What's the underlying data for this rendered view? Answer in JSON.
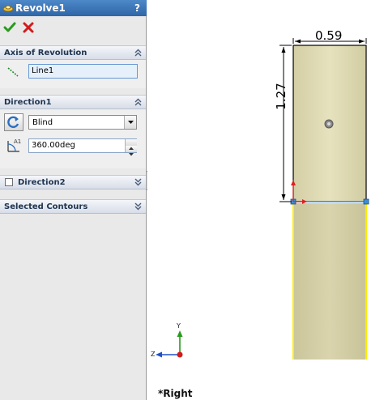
{
  "property_manager": {
    "title": "Revolve1",
    "help": "?",
    "axis_of_revolution": {
      "header": "Axis of Revolution",
      "value": "Line1"
    },
    "direction1": {
      "header": "Direction1",
      "end_condition": "Blind",
      "angle": "360.00deg"
    },
    "direction2": {
      "header": "Direction2"
    },
    "selected_contours": {
      "header": "Selected Contours"
    }
  },
  "graphics": {
    "dim_width": "0.59",
    "dim_height": "1.27",
    "view_name": "*Right",
    "triad_y": "Y",
    "triad_z": "Z"
  },
  "colors": {
    "title_bar": "#2f65a8",
    "ok": "#2a9a1e",
    "cancel": "#d01c1c",
    "sketch_face": "#d7d2a8",
    "highlight_edge": "#ffee00",
    "axis_line": "#3b8ed8",
    "icons": [
      "revolve-icon",
      "help-icon",
      "checkmark-icon",
      "x-icon",
      "line-axis-icon",
      "reverse-direction-icon",
      "angle-icon",
      "chevron-double-up-icon",
      "chevron-double-down-icon"
    ]
  }
}
